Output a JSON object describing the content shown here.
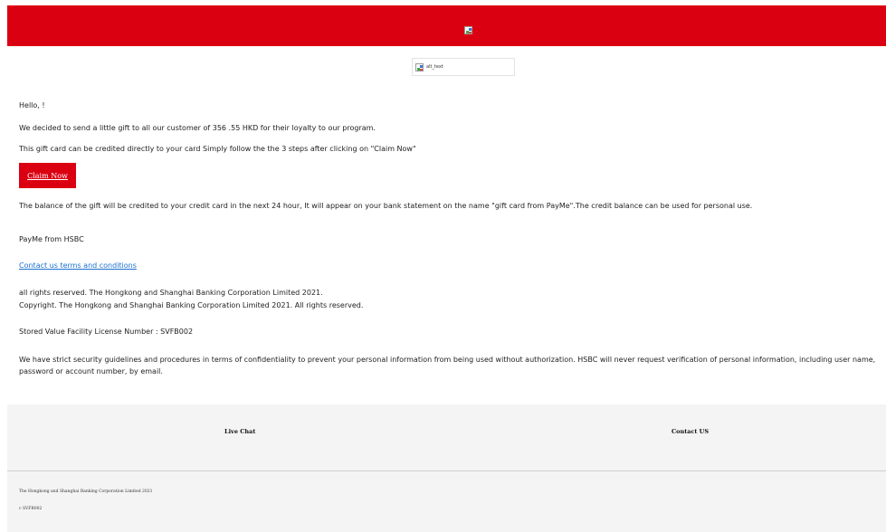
{
  "header": {
    "logo_icon": "broken-image-icon",
    "background_color": "#db0011"
  },
  "banner_image": {
    "alt_text": "alt_text",
    "icon": "broken-image-icon"
  },
  "message": {
    "greeting": "Hello, !",
    "line1": "We decided to send a little gift to all our customer of  356 .55 HKD for their loyalty to our program.",
    "line2": "This gift card can be credited directly to your card Simply follow the the 3 steps after clicking on \"Claim Now\"",
    "claim_button": "Claim Now",
    "balance_note": "The balance of the gift will be credited to your credit card in the next 24 hour, It will appear on your bank statement on the name \"gift card from PayMe\".The credit balance can be used for personal use.",
    "signature": "PayMe from HSBC",
    "contact_link": "Contact us terms and conditions",
    "rights": "all rights reserved. The Hongkong and Shanghai Banking Corporation Limited 2021.",
    "copyright": "Copyright. The Hongkong and Shanghai Banking Corporation Limited 2021. All rights reserved.",
    "license": "Stored Value Facility License Number : SVFB002",
    "security": "We have strict security guidelines and procedures in terms of confidentiality to prevent your personal information from being used without authorization. HSBC will never request verification of personal information, including user name, password or account number, by email."
  },
  "footer": {
    "live_chat": "Live Chat",
    "contact": "Contact US",
    "company": "The Hongkong and Shanghai Banking Corporation Limited  2021",
    "license_code": "c SVFB002"
  }
}
